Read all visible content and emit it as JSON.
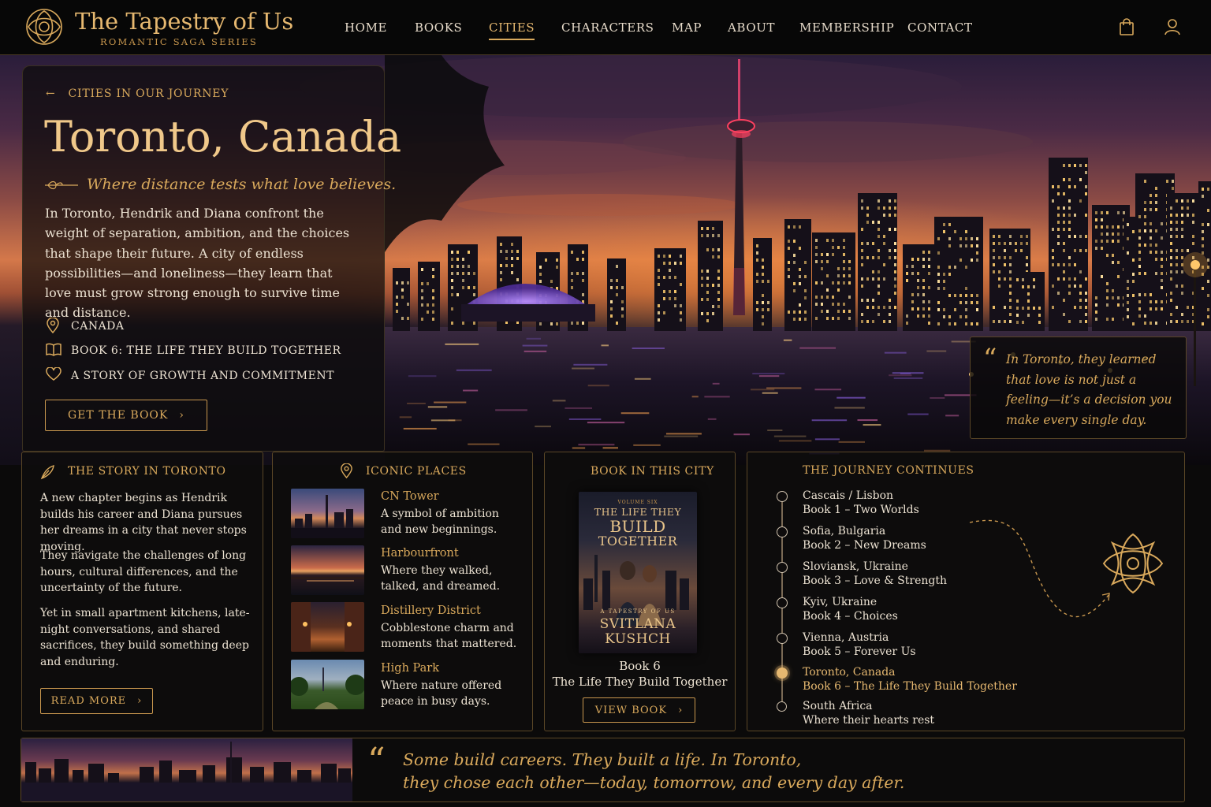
{
  "brand": {
    "title": "The Tapestry of Us",
    "subtitle": "ROMANTIC SAGA SERIES"
  },
  "nav": [
    "HOME",
    "BOOKS",
    "CITIES",
    "CHARACTERS",
    "MAP",
    "ABOUT",
    "MEMBERSHIP",
    "CONTACT"
  ],
  "nav_active": "CITIES",
  "header_icons": [
    "shopping-bag-icon",
    "user-icon"
  ],
  "intro": {
    "breadcrumb": "CITIES IN OUR JOURNEY",
    "title": "Toronto, Canada",
    "tagline": "Where distance tests what love believes.",
    "body": "In Toronto, Hendrik and Diana confront the weight of separation, ambition, and the choices that shape their future. A city of endless possibilities—and loneliness—they learn that love must grow strong enough to survive time and distance.",
    "facts": [
      {
        "icon": "map-pin-icon",
        "text": "CANADA"
      },
      {
        "icon": "open-book-icon",
        "text": "BOOK 6: THE LIFE THEY BUILD TOGETHER"
      },
      {
        "icon": "heart-icon",
        "text": "A STORY OF GROWTH AND COMMITMENT"
      }
    ],
    "cta": "GET THE BOOK"
  },
  "hero_quote": "In Toronto, they learned that love is not just a feeling—it’s a decision you make every single day.",
  "story": {
    "title": "THE STORY IN TORONTO",
    "paragraphs": [
      "A new chapter begins as Hendrik builds his career and Diana pursues her dreams in a city that never stops moving.",
      "They navigate the challenges of long hours, cultural differences, and the uncertainty of the future.",
      "Yet in small apartment kitchens, late-night conversations, and shared sacrifices, they build something deep and enduring."
    ],
    "cta": "READ MORE"
  },
  "places": {
    "title": "ICONIC PLACES",
    "items": [
      {
        "name": "CN Tower",
        "desc": "A symbol of ambition and new beginnings."
      },
      {
        "name": "Harbourfront",
        "desc": "Where they walked, talked, and dreamed."
      },
      {
        "name": "Distillery District",
        "desc": "Cobblestone charm and moments that mattered."
      },
      {
        "name": "High Park",
        "desc": "Where nature offered peace in busy days."
      }
    ]
  },
  "book": {
    "title": "BOOK IN THIS CITY",
    "cover_top": "VOLUME SIX",
    "cover_line1": "THE LIFE THEY",
    "cover_line2": "BUILD",
    "cover_line3": "TOGETHER",
    "cover_series": "A TAPESTRY OF US",
    "cover_author1": "SVITLANA",
    "cover_author2": "KUSHCH",
    "number": "Book 6",
    "name": "The Life They Build Together",
    "cta": "VIEW BOOK"
  },
  "journey": {
    "title": "THE JOURNEY CONTINUES",
    "items": [
      {
        "place": "Cascais / Lisbon",
        "book": "Book 1 – Two Worlds"
      },
      {
        "place": "Sofia, Bulgaria",
        "book": "Book 2 – New Dreams"
      },
      {
        "place": "Sloviansk, Ukraine",
        "book": "Book 3 – Love & Strength"
      },
      {
        "place": "Kyiv, Ukraine",
        "book": "Book 4 – Choices"
      },
      {
        "place": "Vienna, Austria",
        "book": "Book 5 – Forever Us"
      },
      {
        "place": "Toronto, Canada",
        "book": "Book 6 – The Life They Build Together"
      },
      {
        "place": "South Africa",
        "book": "Where their hearts rest"
      }
    ],
    "active_index": 5
  },
  "banner_quote": {
    "line1": "Some build careers. They built a life. In Toronto,",
    "line2": "they chose each other—today, tomorrow, and every day after."
  },
  "colors": {
    "accent": "#d9a95c",
    "accent_light": "#e6b870",
    "background": "#0b0a0a",
    "text": "#ece2d2"
  }
}
